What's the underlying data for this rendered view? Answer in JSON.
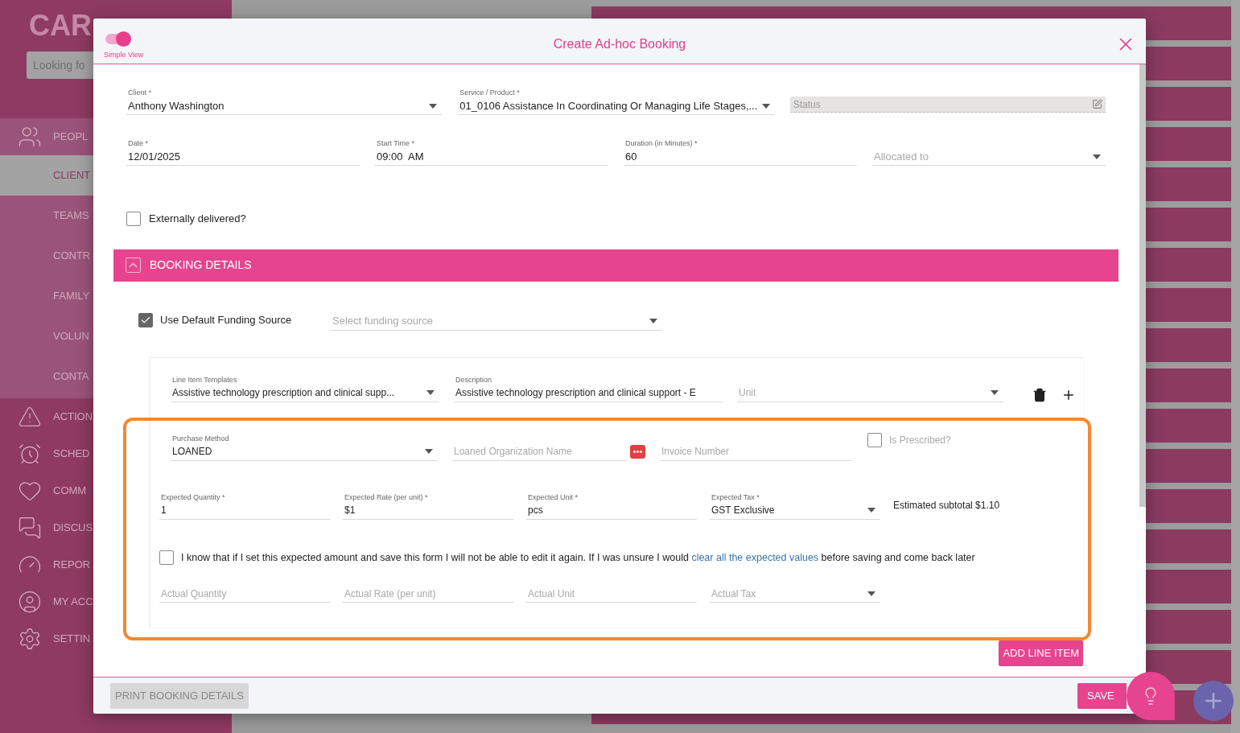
{
  "sidebar": {
    "logo": "CAR",
    "search": {
      "placeholder": "Looking fo"
    },
    "items": [
      {
        "label": "PEOPL",
        "selected": false,
        "children": [
          {
            "label": "CLIENT",
            "selected": true
          },
          {
            "label": "TEAMS",
            "selected": false
          },
          {
            "label": "CONTR",
            "selected": false
          },
          {
            "label": "FAMILY",
            "selected": false
          },
          {
            "label": "VOLUN",
            "selected": false
          },
          {
            "label": "CONTA",
            "selected": false
          }
        ]
      },
      {
        "label": "ACTION",
        "selected": false
      },
      {
        "label": "SCHED",
        "selected": false
      },
      {
        "label": "COMM",
        "selected": false
      },
      {
        "label": "DISCUS",
        "selected": false
      },
      {
        "label": "REPOR",
        "selected": false
      },
      {
        "label": "MY ACC",
        "selected": false
      },
      {
        "label": "SETTIN",
        "selected": false
      }
    ]
  },
  "modal": {
    "title": "Create Ad-hoc Booking",
    "simple_view": {
      "label": "Simple View",
      "on": true
    },
    "header_fields": [
      {
        "label": "Client *",
        "value": "Anthony Washington",
        "kind": "select"
      },
      {
        "label": "Service / Product *",
        "value": "01_0106 Assistance In Coordinating Or Managing Life Stages,...",
        "kind": "select"
      },
      {
        "placeholder": "Status",
        "kind": "locked"
      }
    ],
    "schedule_fields": [
      {
        "label": "Date *",
        "value": "12/01/2025",
        "kind": "text"
      },
      {
        "label": "Start Time *",
        "value": "09:00  AM",
        "kind": "text"
      },
      {
        "label": "Duration (in Minutes) *",
        "value": "60",
        "kind": "text"
      },
      {
        "placeholder": "Allocated to",
        "kind": "select"
      }
    ],
    "externally_delivered": {
      "label": "Externally delivered?",
      "checked": false
    },
    "booking_details": {
      "title": "BOOKING DETAILS",
      "expanded": true,
      "use_default_funding": {
        "label": "Use Default Funding Source",
        "checked": true
      },
      "funding_source": {
        "placeholder": "Select funding source",
        "kind": "select"
      },
      "line_item": {
        "template": {
          "label": "Line Item Templates",
          "value": "Assistive technology prescription and clinical supp...",
          "kind": "select"
        },
        "description": {
          "label": "Description",
          "value": "Assistive technology prescription and clinical support - E",
          "kind": "text"
        },
        "unit": {
          "placeholder": "Unit",
          "kind": "select"
        },
        "purchase_method": {
          "label": "Purchase Method",
          "value": "LOANED",
          "kind": "select"
        },
        "loaned_organization": {
          "placeholder": "Loaned Organization Name",
          "kind": "text"
        },
        "invoice_number": {
          "placeholder": "Invoice Number",
          "kind": "text"
        },
        "is_prescribed": {
          "label": "Is Prescribed?",
          "checked": false
        },
        "expected": [
          {
            "label": "Expected Quantity *",
            "value": "1",
            "kind": "text"
          },
          {
            "label": "Expected Rate (per unit) *",
            "value": "$1",
            "kind": "text"
          },
          {
            "label": "Expected Unit *",
            "value": "pcs",
            "kind": "text"
          },
          {
            "label": "Expected Tax *",
            "value": "GST Exclusive",
            "kind": "select"
          }
        ],
        "subtotal": "Estimated subtotal $1.10",
        "acknowledgement": {
          "checked": false,
          "text_before": "I know that if I set this expected amount and save this form I will not be able to edit it again. If I was unsure I would ",
          "link": "clear all the expected values",
          "text_after": " before saving and come back later"
        },
        "actual": [
          {
            "placeholder": "Actual Quantity",
            "kind": "text"
          },
          {
            "placeholder": "Actual Rate (per unit)",
            "kind": "text"
          },
          {
            "placeholder": "Actual Unit",
            "kind": "text"
          },
          {
            "placeholder": "Actual Tax",
            "kind": "select"
          }
        ]
      },
      "add_line_item": "ADD LINE ITEM"
    },
    "print_button": "PRINT BOOKING DETAILS",
    "save_button": "SAVE"
  }
}
